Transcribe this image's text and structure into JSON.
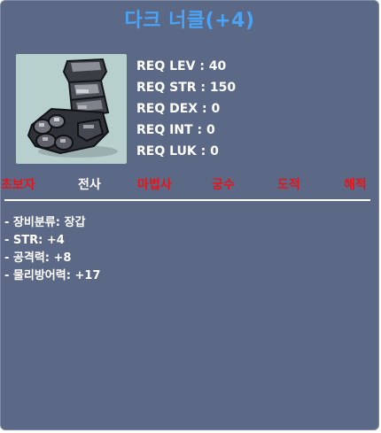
{
  "item": {
    "name": "다크 너클(+4)",
    "title_color": "#4aa3f5",
    "icon": "dark-knuckle-glove-icon"
  },
  "requirements": [
    "REQ LEV : 40",
    "REQ STR : 150",
    "REQ DEX : 0",
    "REQ INT : 0",
    "REQ LUK : 0"
  ],
  "jobs": [
    {
      "label": "초보자",
      "enabled": false
    },
    {
      "label": "전사",
      "enabled": true
    },
    {
      "label": "마법사",
      "enabled": false
    },
    {
      "label": "궁수",
      "enabled": false
    },
    {
      "label": "도적",
      "enabled": false
    },
    {
      "label": "해적",
      "enabled": false
    }
  ],
  "stats": [
    "- 장비분류: 장갑",
    "- STR: +4",
    "- 공격력: +8",
    "- 물리방어력: +17"
  ],
  "colors": {
    "background": "#5b6886",
    "disabled_job": "#e5161b",
    "enabled_job": "#ffffff"
  }
}
